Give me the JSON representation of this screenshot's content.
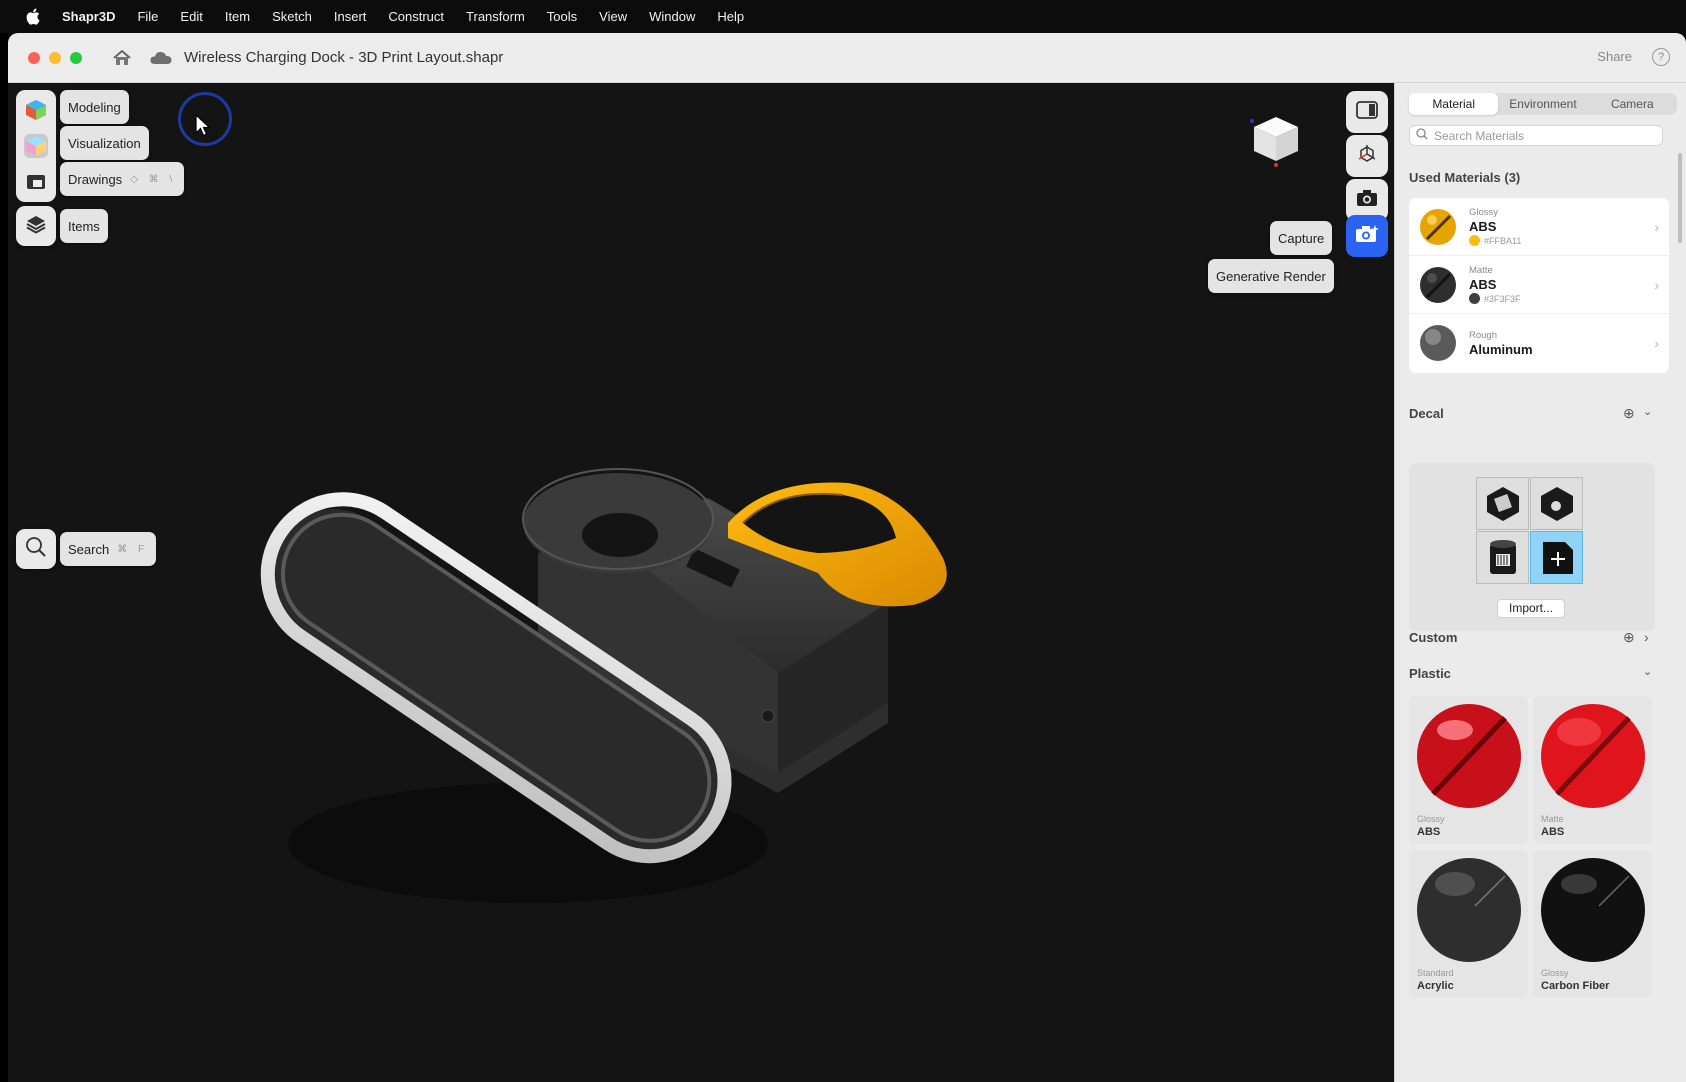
{
  "menubar": {
    "app_name": "Shapr3D",
    "items": [
      "File",
      "Edit",
      "Item",
      "Sketch",
      "Insert",
      "Construct",
      "Transform",
      "Tools",
      "View",
      "Window",
      "Help"
    ]
  },
  "titlebar": {
    "document_title": "Wireless Charging Dock - 3D Print Layout.shapr",
    "share_label": "Share",
    "help_label": "?"
  },
  "left_toolbar": {
    "modeling_label": "Modeling",
    "visualization_label": "Visualization",
    "drawings_label": "Drawings",
    "drawings_shortcut": "◇ ⌘ \\",
    "items_label": "Items",
    "search_label": "Search",
    "search_shortcut": "⌘ F"
  },
  "right_toolbar": {
    "capture_label": "Capture",
    "generative_render_label": "Generative Render"
  },
  "panel": {
    "tabs": [
      {
        "label": "Material",
        "active": true
      },
      {
        "label": "Environment",
        "active": false
      },
      {
        "label": "Camera",
        "active": false
      }
    ],
    "search_placeholder": "Search Materials",
    "used_materials_title": "Used Materials (3)",
    "used_materials": [
      {
        "finish": "Glossy",
        "name": "ABS",
        "hex": "#FFBA11",
        "color": "#FFBA11"
      },
      {
        "finish": "Matte",
        "name": "ABS",
        "hex": "#3F3F3F",
        "color": "#3F3F3F"
      },
      {
        "finish": "Rough",
        "name": "Aluminum",
        "hex": "",
        "color": "#8a8a8a"
      }
    ],
    "decal_title": "Decal",
    "import_label": "Import...",
    "custom_title": "Custom",
    "plastic_title": "Plastic",
    "plastic_materials": [
      {
        "finish": "Glossy",
        "name": "ABS",
        "color": "#d8131c"
      },
      {
        "finish": "Matte",
        "name": "ABS",
        "color": "#e0141c"
      },
      {
        "finish": "Standard",
        "name": "Acrylic",
        "color": "#2e2e2e"
      },
      {
        "finish": "Glossy",
        "name": "Carbon Fiber",
        "color": "#111111"
      }
    ]
  },
  "colors": {
    "accent_blue": "#2a63f2",
    "highlight_orange": "#f0a500"
  }
}
